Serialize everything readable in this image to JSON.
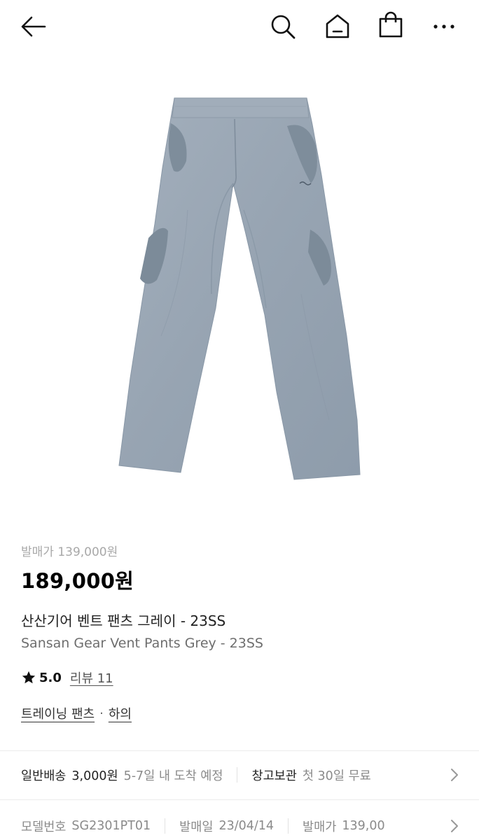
{
  "header": {
    "back_icon": "arrow-left-icon",
    "search_icon": "search-icon",
    "home_icon": "home-icon",
    "cart_icon": "shopping-bag-icon",
    "more_icon": "more-horizontal-icon"
  },
  "product": {
    "image_alt_colors": {
      "pants": "#9aa7b4",
      "panel": "#7c8b99"
    },
    "release_price": "발매가 139,000원",
    "price": "189,000원",
    "name_ko": "산산기어 벤트 팬츠 그레이 - 23SS",
    "name_en": "Sansan Gear Vent Pants Grey - 23SS",
    "rating": "5.0",
    "review_label": "리뷰 11",
    "category_main": "트레이닝 팬츠",
    "category_separator": "·",
    "category_sub": "하의"
  },
  "shipping": {
    "method_label": "일반배송",
    "fee": "3,000원",
    "eta": "5-7일 내 도착 예정",
    "storage_label": "창고보관",
    "storage_desc": "첫 30일 무료"
  },
  "details": {
    "model_label": "모델번호",
    "model_value": "SG2301PT01",
    "release_date_label": "발매일",
    "release_date_value": "23/04/14",
    "release_price_label": "발매가",
    "release_price_value": "139,00"
  }
}
